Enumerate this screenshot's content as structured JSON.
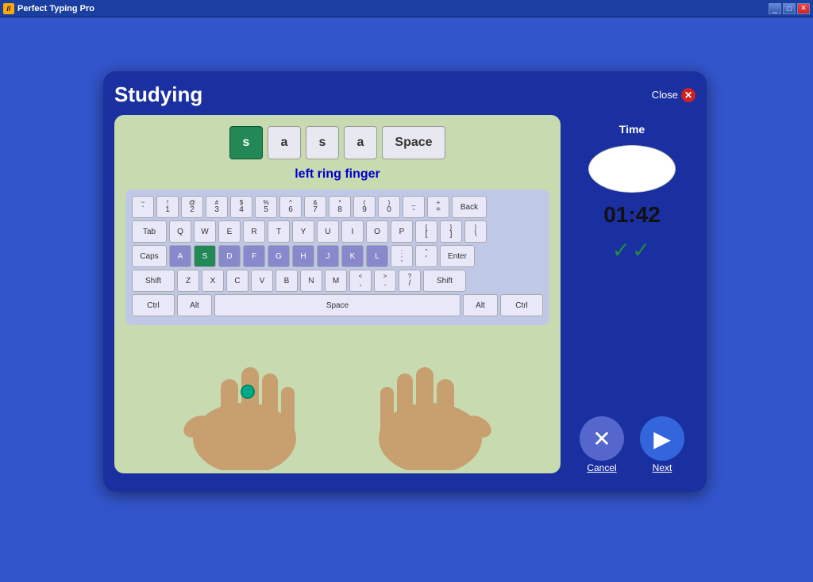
{
  "titleBar": {
    "title": "Perfect Typing Pro",
    "iconText": "//",
    "minimizeLabel": "_",
    "maximizeLabel": "□",
    "closeLabel": "✕"
  },
  "window": {
    "title": "Studying",
    "closeLabel": "Close"
  },
  "keyDisplay": {
    "keys": [
      {
        "char": "s",
        "active": true
      },
      {
        "char": "a",
        "active": false
      },
      {
        "char": "s",
        "active": false
      },
      {
        "char": "a",
        "active": false
      },
      {
        "char": "Space",
        "active": false,
        "wide": true
      }
    ],
    "fingerLabel": "left ring finger"
  },
  "keyboard": {
    "rows": [
      [
        {
          "label": "~`",
          "dual": true,
          "top": "~",
          "bot": "`"
        },
        {
          "label": "!1",
          "dual": true,
          "top": "!",
          "bot": "1"
        },
        {
          "label": "@2",
          "dual": true,
          "top": "@",
          "bot": "2"
        },
        {
          "label": "#3",
          "dual": true,
          "top": "#",
          "bot": "3"
        },
        {
          "label": "$4",
          "dual": true,
          "top": "$",
          "bot": "4"
        },
        {
          "label": "%5",
          "dual": true,
          "top": "%",
          "bot": "5"
        },
        {
          "label": "^6",
          "dual": true,
          "top": "^",
          "bot": "6"
        },
        {
          "label": "&7",
          "dual": true,
          "top": "&",
          "bot": "7"
        },
        {
          "label": "*8",
          "dual": true,
          "top": "*",
          "bot": "8"
        },
        {
          "label": "(9",
          "dual": true,
          "top": "(",
          "bot": "9"
        },
        {
          "label": ")0",
          "dual": true,
          "top": ")",
          "bot": "0"
        },
        {
          "label": "_-",
          "dual": true,
          "top": "_",
          "bot": "-"
        },
        {
          "label": "+=",
          "dual": true,
          "top": "+",
          "bot": "="
        },
        {
          "label": "Back",
          "wide": true
        }
      ],
      [
        {
          "label": "Tab",
          "wide": true
        },
        {
          "label": "Q"
        },
        {
          "label": "W"
        },
        {
          "label": "E"
        },
        {
          "label": "R"
        },
        {
          "label": "T"
        },
        {
          "label": "Y"
        },
        {
          "label": "U"
        },
        {
          "label": "I"
        },
        {
          "label": "O"
        },
        {
          "label": "P"
        },
        {
          "label": "{[",
          "dual": true,
          "top": "{",
          "bot": "["
        },
        {
          "label": "}]",
          "dual": true,
          "top": "}",
          "bot": "]"
        },
        {
          "label": "|\\",
          "dual": true,
          "top": "|",
          "bot": "\\"
        }
      ],
      [
        {
          "label": "Caps",
          "wide": true
        },
        {
          "label": "A"
        },
        {
          "label": "S",
          "activeKey": true
        },
        {
          "label": "D"
        },
        {
          "label": "F"
        },
        {
          "label": "G"
        },
        {
          "label": "H"
        },
        {
          "label": "J"
        },
        {
          "label": "K"
        },
        {
          "label": "L"
        },
        {
          "label": ":;",
          "dual": true,
          "top": ":",
          "bot": ";"
        },
        {
          "label": "\"'",
          "dual": true,
          "top": "\"",
          "bot": "'"
        },
        {
          "label": "Enter",
          "wide": true
        }
      ],
      [
        {
          "label": "Shift",
          "wider": true
        },
        {
          "label": "Z"
        },
        {
          "label": "X"
        },
        {
          "label": "C"
        },
        {
          "label": "V"
        },
        {
          "label": "B"
        },
        {
          "label": "N"
        },
        {
          "label": "M"
        },
        {
          "label": "<,",
          "dual": true,
          "top": "<",
          "bot": ","
        },
        {
          "label": ">.",
          "dual": true,
          "top": ">",
          "bot": "."
        },
        {
          "label": "?/",
          "dual": true,
          "top": "?",
          "bot": "/"
        },
        {
          "label": "Shift",
          "wider": true
        }
      ],
      [
        {
          "label": "Ctrl",
          "wider": true
        },
        {
          "label": "Alt",
          "wide": true
        },
        {
          "label": "Space",
          "spacebar": true
        },
        {
          "label": "Alt",
          "wide": true
        },
        {
          "label": "Ctrl",
          "wider": true
        }
      ]
    ]
  },
  "rightPanel": {
    "timeLabel": "Time",
    "timeDisplay": "01:42",
    "checkmarks": "✓✓"
  },
  "buttons": {
    "cancelLabel": "Cancel",
    "nextLabel": "Next"
  }
}
